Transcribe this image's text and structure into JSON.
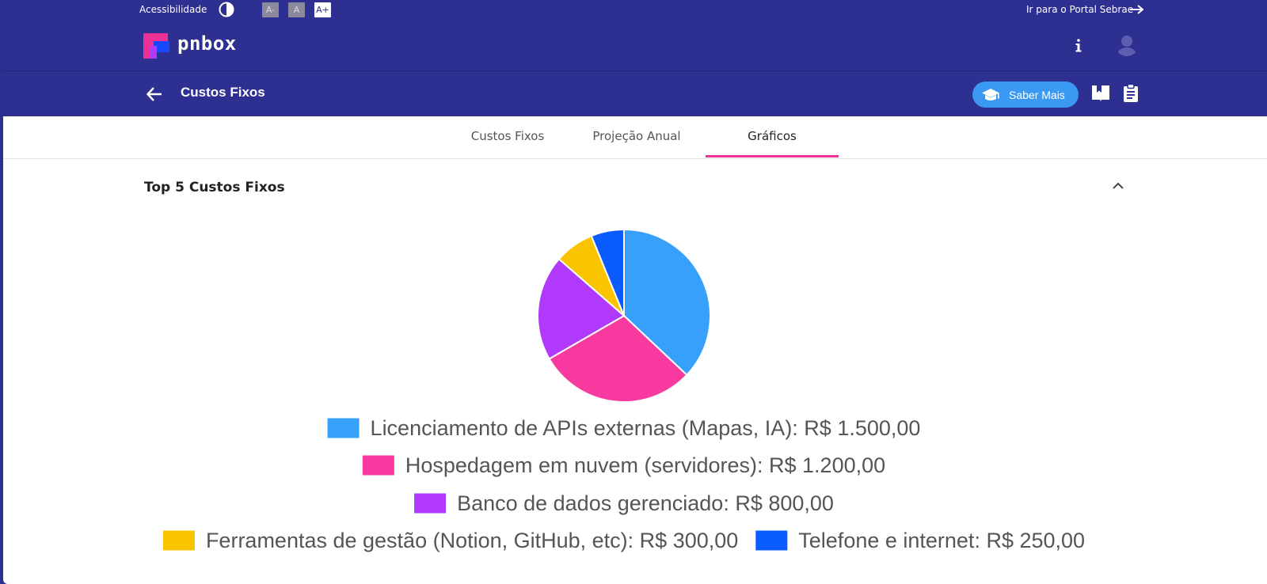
{
  "accessibility_bar": {
    "label": "Acessibilidade",
    "font_decrease": "A-",
    "font_default": "A",
    "font_increase": "A+",
    "portal_link": "Ir para o Portal Sebrae"
  },
  "header": {
    "logo_text": "pnbox",
    "info_icon": "info-icon",
    "avatar_icon": "user-avatar-icon"
  },
  "subheader": {
    "title": "Custos Fixos",
    "saber_mais_label": "Saber Mais",
    "icons": [
      "back-arrow-icon",
      "graduation-cap-icon",
      "book-icon",
      "clipboard-icon"
    ]
  },
  "tabs": [
    {
      "label": "Custos Fixos",
      "active": false
    },
    {
      "label": "Projeção Anual",
      "active": false
    },
    {
      "label": "Gráficos",
      "active": true
    }
  ],
  "panel": {
    "title": "Top 5 Custos Fixos",
    "expanded": true
  },
  "colors": {
    "brand_navy": "#2d2f91",
    "accent_pink": "#ef3196",
    "button_blue": "#3a9af3"
  },
  "chart_data": {
    "type": "pie",
    "title": "",
    "legend_position": "bottom",
    "slices": [
      {
        "label": "Licenciamento de APIs externas (Mapas, IA): R$ 1.500,00",
        "value": 1500,
        "color": "#36a0fb"
      },
      {
        "label": "Hospedagem em nuvem (servidores): R$ 1.200,00",
        "value": 1200,
        "color": "#f83aa0"
      },
      {
        "label": "Banco de dados gerenciado: R$ 800,00",
        "value": 800,
        "color": "#b039fb"
      },
      {
        "label": "Ferramentas de gestão (Notion, GitHub, etc): R$ 300,00",
        "value": 300,
        "color": "#fbc400"
      },
      {
        "label": "Telefone e internet: R$ 250,00",
        "value": 250,
        "color": "#0a5cff"
      }
    ]
  }
}
